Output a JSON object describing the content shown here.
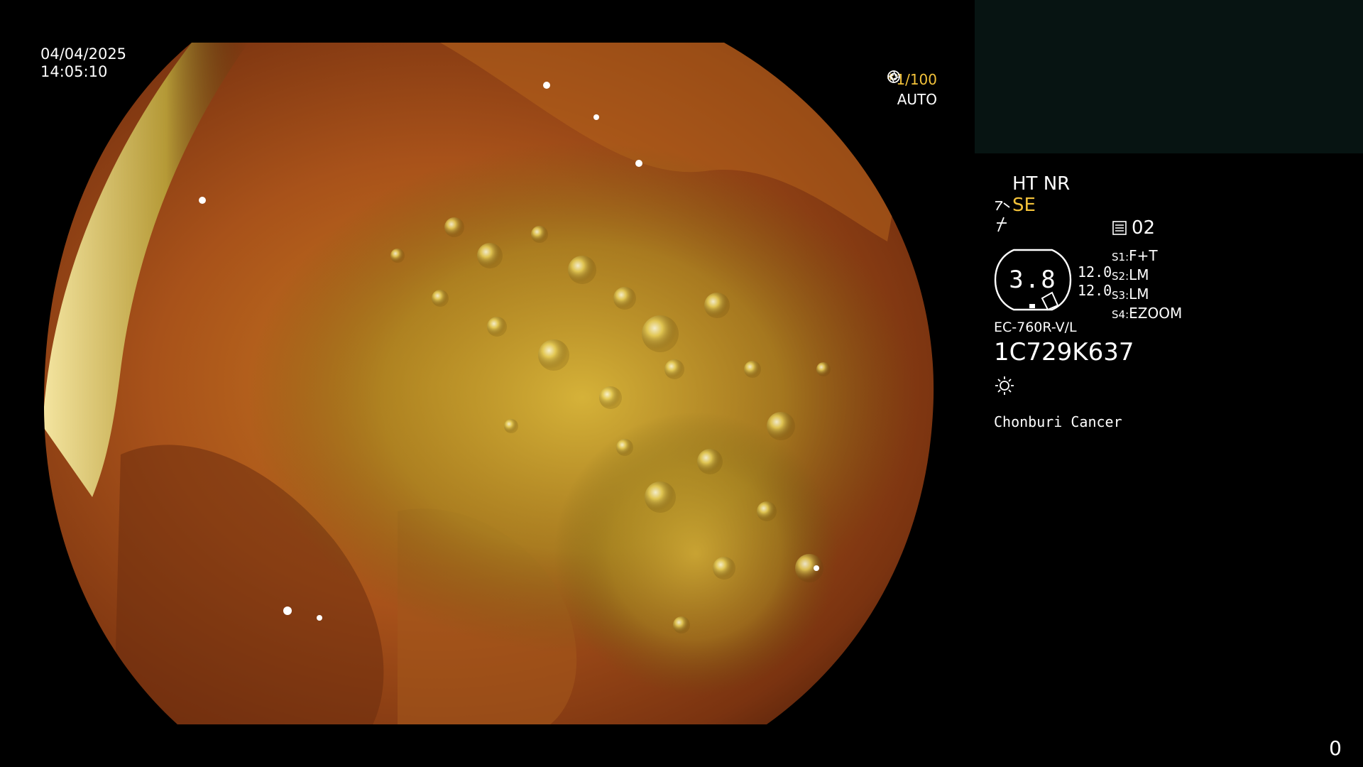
{
  "overlay": {
    "date": "04/04/2025",
    "time": "14:05:10",
    "shutter_value": "1/100",
    "shutter_prefix": "*",
    "auto_label": "AUTO"
  },
  "panel": {
    "ht_nr": "HT NR",
    "se_label": "SE",
    "preset": "02",
    "zoom_value": "3.8",
    "zoom_line1": "12.0",
    "zoom_line2": "12.0",
    "modes": [
      {
        "label": "S1:",
        "value": "F+T"
      },
      {
        "label": "S2:",
        "value": "LM"
      },
      {
        "label": "S3:",
        "value": "LM"
      },
      {
        "label": "S4:",
        "value": "EZOOM"
      }
    ],
    "model": "EC-760R-V/L",
    "serial": "1C729K637",
    "hospital": "Chonburi Cancer",
    "page_number": "0"
  },
  "colors": {
    "accent_yellow": "#f3c23a",
    "thumb_panel": "#071412"
  },
  "icons": {
    "shutter": "aperture-icon",
    "auto": "iris-icon",
    "se": "structure-enhance-icon",
    "sharp": "sharpness-icon",
    "preset": "memo-icon",
    "light": "light-icon"
  }
}
